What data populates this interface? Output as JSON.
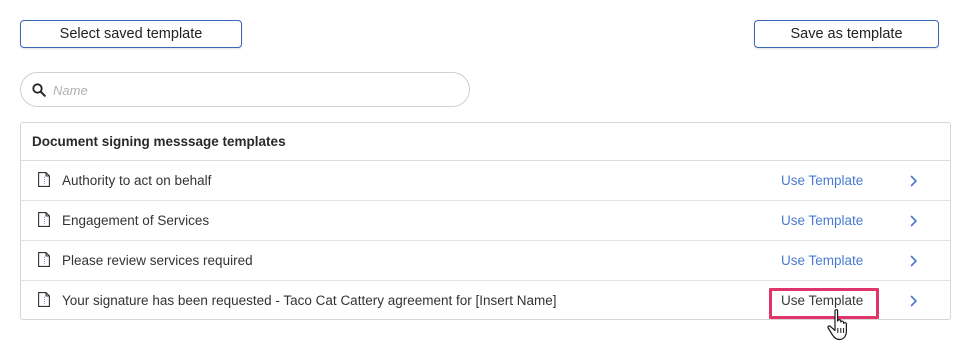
{
  "toolbar": {
    "select_label": "Select saved template",
    "save_label": "Save as template"
  },
  "search": {
    "placeholder": "Name",
    "value": ""
  },
  "panel": {
    "header": "Document signing messsage templates",
    "rows": [
      {
        "title": "Authority to act on behalf",
        "action": "Use Template"
      },
      {
        "title": "Engagement of Services",
        "action": "Use Template"
      },
      {
        "title": "Please review services required",
        "action": "Use Template"
      },
      {
        "title": "Your signature has been requested - Taco Cat Cattery agreement for [Insert Name]",
        "action": "Use Template"
      }
    ]
  },
  "colors": {
    "button_border": "#3a67b8",
    "link": "#4a7bd1",
    "highlight": "#e0356a"
  },
  "icons": {
    "search": "search-icon",
    "document": "document-icon",
    "chevron": "chevron-right-icon",
    "cursor": "hand-pointer-cursor"
  }
}
